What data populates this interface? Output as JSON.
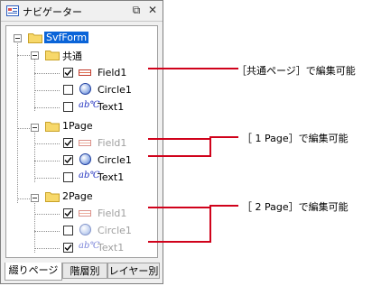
{
  "window": {
    "title": "ナビゲーター",
    "buttons": [
      "⧉",
      "✕"
    ]
  },
  "tree": {
    "root": "SvfForm",
    "groups": [
      {
        "label": "共通",
        "items": [
          {
            "label": "Field1",
            "checked": true,
            "dim": false,
            "icon": "field-icon"
          }
        ]
      },
      {
        "label": "1Page",
        "items": [
          {
            "label": "Field1",
            "checked": true,
            "dim": true,
            "icon": "field-icon"
          },
          {
            "label": "Circle1",
            "checked": true,
            "dim": false,
            "icon": "circle-icon"
          },
          {
            "label": "Text1",
            "checked": false,
            "dim": false,
            "icon": "text-icon"
          }
        ]
      },
      {
        "label": "2Page",
        "items": [
          {
            "label": "Field1",
            "checked": true,
            "dim": true,
            "icon": "field-icon"
          },
          {
            "label": "Circle1",
            "checked": false,
            "dim": true,
            "icon": "circle-icon"
          },
          {
            "label": "Text1",
            "checked": true,
            "dim": true,
            "icon": "text-icon"
          }
        ]
      }
    ],
    "common_extra": [
      {
        "label": "Circle1",
        "checked": false,
        "icon": "circle-icon"
      },
      {
        "label": "Text1",
        "checked": false,
        "icon": "text-icon"
      }
    ]
  },
  "tabs": [
    "綴りページ",
    "階層別",
    "レイヤー別"
  ],
  "callouts": [
    "［共通ページ］で編集可能",
    "［ 1 Page］で編集可能",
    "［ 2 Page］で編集可能"
  ],
  "colors": {
    "accent": "#d0021b",
    "selection": "#0a64d8"
  }
}
